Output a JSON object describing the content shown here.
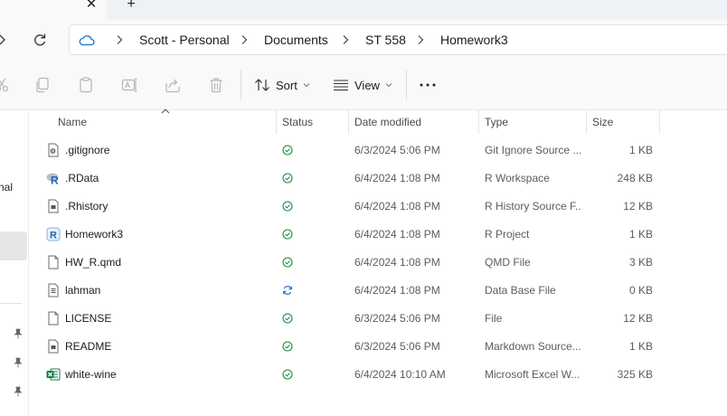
{
  "tabs": {
    "close_glyph": "✕",
    "new_glyph": "+"
  },
  "breadcrumb": [
    "Scott - Personal",
    "Documents",
    "ST 558",
    "Homework3"
  ],
  "toolbar": {
    "sort_label": "Sort",
    "view_label": "View",
    "icons": [
      "cut-icon",
      "copy-icon",
      "paste-icon",
      "rename-icon",
      "share-icon",
      "delete-icon"
    ]
  },
  "nav_pane": {
    "partial_label": "nal"
  },
  "columns": {
    "name": "Name",
    "status": "Status",
    "date": "Date modified",
    "type": "Type",
    "size": "Size"
  },
  "files": [
    {
      "name": ".gitignore",
      "status": "synced",
      "date": "6/3/2024 5:06 PM",
      "type": "Git Ignore Source ...",
      "size": "1 KB",
      "icon": "gitignore-file-icon"
    },
    {
      "name": ".RData",
      "status": "synced",
      "date": "6/4/2024 1:08 PM",
      "type": "R Workspace",
      "size": "248 KB",
      "icon": "r-workspace-icon"
    },
    {
      "name": ".Rhistory",
      "status": "synced",
      "date": "6/4/2024 1:08 PM",
      "type": "R History Source F...",
      "size": "12 KB",
      "icon": "r-history-file-icon"
    },
    {
      "name": "Homework3",
      "status": "synced",
      "date": "6/4/2024 1:08 PM",
      "type": "R Project",
      "size": "1 KB",
      "icon": "r-project-icon"
    },
    {
      "name": "HW_R.qmd",
      "status": "synced",
      "date": "6/4/2024 1:08 PM",
      "type": "QMD File",
      "size": "3 KB",
      "icon": "blank-file-icon"
    },
    {
      "name": "lahman",
      "status": "syncing",
      "date": "6/4/2024 1:08 PM",
      "type": "Data Base File",
      "size": "0 KB",
      "icon": "database-file-icon"
    },
    {
      "name": "LICENSE",
      "status": "synced",
      "date": "6/3/2024 5:06 PM",
      "type": "File",
      "size": "12 KB",
      "icon": "blank-file-icon"
    },
    {
      "name": "README",
      "status": "synced",
      "date": "6/3/2024 5:06 PM",
      "type": "Markdown Source...",
      "size": "1 KB",
      "icon": "markdown-file-icon"
    },
    {
      "name": "white-wine",
      "status": "synced",
      "date": "6/4/2024 10:10 AM",
      "type": "Microsoft Excel W...",
      "size": "325 KB",
      "icon": "excel-file-icon"
    }
  ],
  "colors": {
    "synced": "#1e8a3c",
    "syncing": "#1f6fd1",
    "cloud": "#1f6fd1",
    "excel": "#107c41",
    "r_blue": "#2165b6"
  }
}
